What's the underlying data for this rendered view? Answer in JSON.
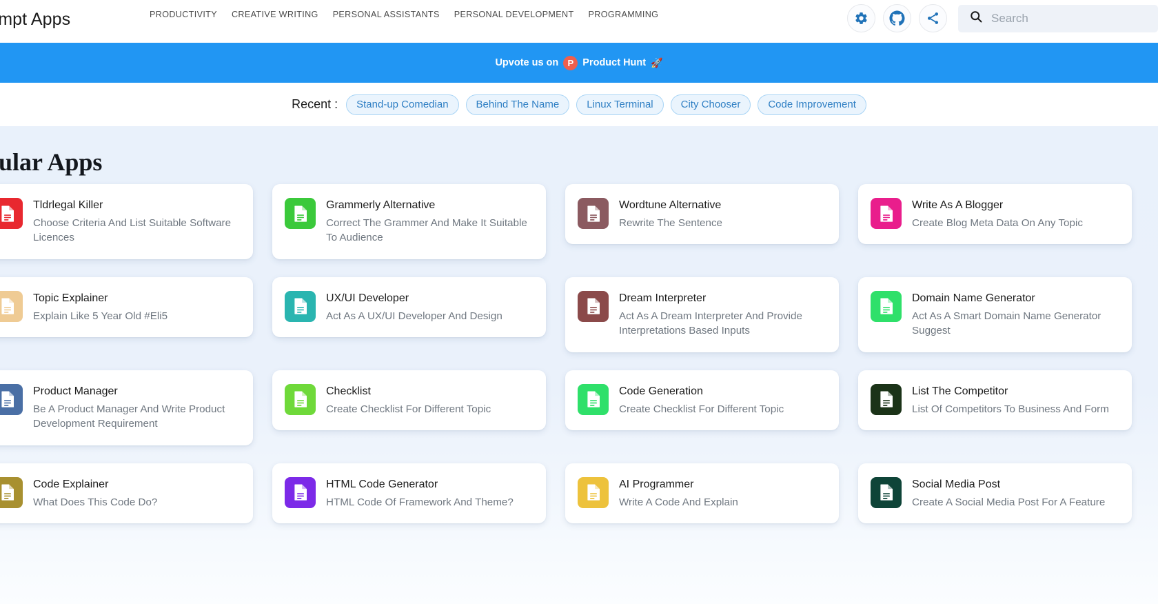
{
  "header": {
    "brand": "Prompt Apps",
    "nav": [
      {
        "label": "PRODUCTIVITY"
      },
      {
        "label": "CREATIVE WRITING"
      },
      {
        "label": "PERSONAL ASSISTANTS"
      },
      {
        "label": "PERSONAL DEVELOPMENT"
      },
      {
        "label": "PROGRAMMING"
      }
    ],
    "actions": [
      {
        "name": "settings-icon",
        "label": "Settings"
      },
      {
        "name": "github-icon",
        "label": "GitHub"
      },
      {
        "name": "share-icon",
        "label": "Share"
      }
    ],
    "search": {
      "placeholder": "Search",
      "value": ""
    }
  },
  "banner": {
    "prefix": "Upvote us on",
    "logo_letter": "P",
    "product": "Product Hunt",
    "emoji": "🚀",
    "bg_color": "#2196f3"
  },
  "recent": {
    "label": "Recent :",
    "chips": [
      "Stand-up Comedian",
      "Behind The Name",
      "Linux Terminal",
      "City Chooser",
      "Code Improvement"
    ]
  },
  "main": {
    "section_title": "Popular Apps",
    "cards": [
      {
        "title": "Tldrlegal Killer",
        "desc": "Choose Criteria And List Suitable Software Licences",
        "color": "#e8282f"
      },
      {
        "title": "Grammerly Alternative",
        "desc": "Correct The Grammer And Make It Suitable To Audience",
        "color": "#3bc93b"
      },
      {
        "title": "Wordtune Alternative",
        "desc": "Rewrite The Sentence",
        "color": "#8b5a60"
      },
      {
        "title": "Write As A Blogger",
        "desc": "Create Blog Meta Data On Any Topic",
        "color": "#e91e8c"
      },
      {
        "title": "Topic Explainer",
        "desc": "Explain Like 5 Year Old #Eli5",
        "color": "#efcb94"
      },
      {
        "title": "UX/UI Developer",
        "desc": "Act As A UX/UI Developer And Design",
        "color": "#2ab5b0"
      },
      {
        "title": "Dream Interpreter",
        "desc": "Act As A Dream Interpreter And Provide Interpretations Based Inputs",
        "color": "#8b4a4a"
      },
      {
        "title": "Domain Name Generator",
        "desc": "Act As A Smart Domain Name Generator Suggest",
        "color": "#2fe06a"
      },
      {
        "title": "Product Manager",
        "desc": "Be A Product Manager And Write Product Development Requirement",
        "color": "#4a6fa5"
      },
      {
        "title": "Checklist",
        "desc": "Create Checklist For Different Topic",
        "color": "#6fd93a"
      },
      {
        "title": "Code Generation",
        "desc": "Create Checklist For Different Topic",
        "color": "#2fe06a"
      },
      {
        "title": "List The Competitor",
        "desc": "List Of Competitors To Business And Form",
        "color": "#1b3318"
      },
      {
        "title": "Code Explainer",
        "desc": "What Does This Code Do?",
        "color": "#a89030"
      },
      {
        "title": "HTML Code Generator",
        "desc": "HTML Code Of Framework And Theme?",
        "color": "#7c2ae8"
      },
      {
        "title": "AI Programmer",
        "desc": "Write A Code And Explain",
        "color": "#edc23c"
      },
      {
        "title": "Social Media Post",
        "desc": "Create A Social Media Post For A Feature",
        "color": "#0e4438"
      }
    ]
  }
}
